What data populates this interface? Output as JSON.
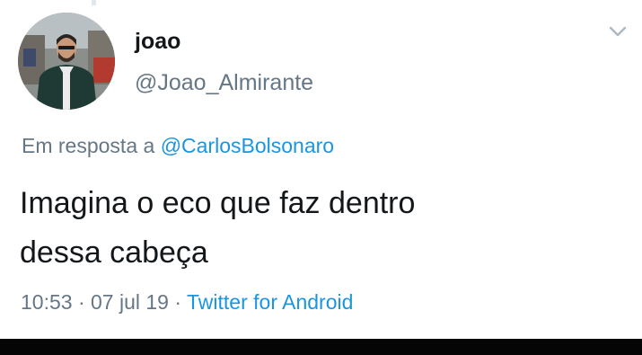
{
  "author": {
    "display_name": "joao",
    "handle": "@Joao_Almirante",
    "avatar_icon": "profile-photo"
  },
  "reply": {
    "prefix": "Em resposta a",
    "mention": "@CarlosBolsonaro"
  },
  "tweet": {
    "text_line1": "Imagina o eco que faz dentro",
    "text_line2": "dessa cabeça"
  },
  "meta": {
    "time": "10:53",
    "sep1": "·",
    "date": "07 jul 19",
    "sep2": "·",
    "source": "Twitter for Android"
  },
  "menu": {
    "icon": "chevron-down-icon"
  },
  "colors": {
    "text": "#14171a",
    "secondary": "#657786",
    "link": "#1b95e0"
  }
}
